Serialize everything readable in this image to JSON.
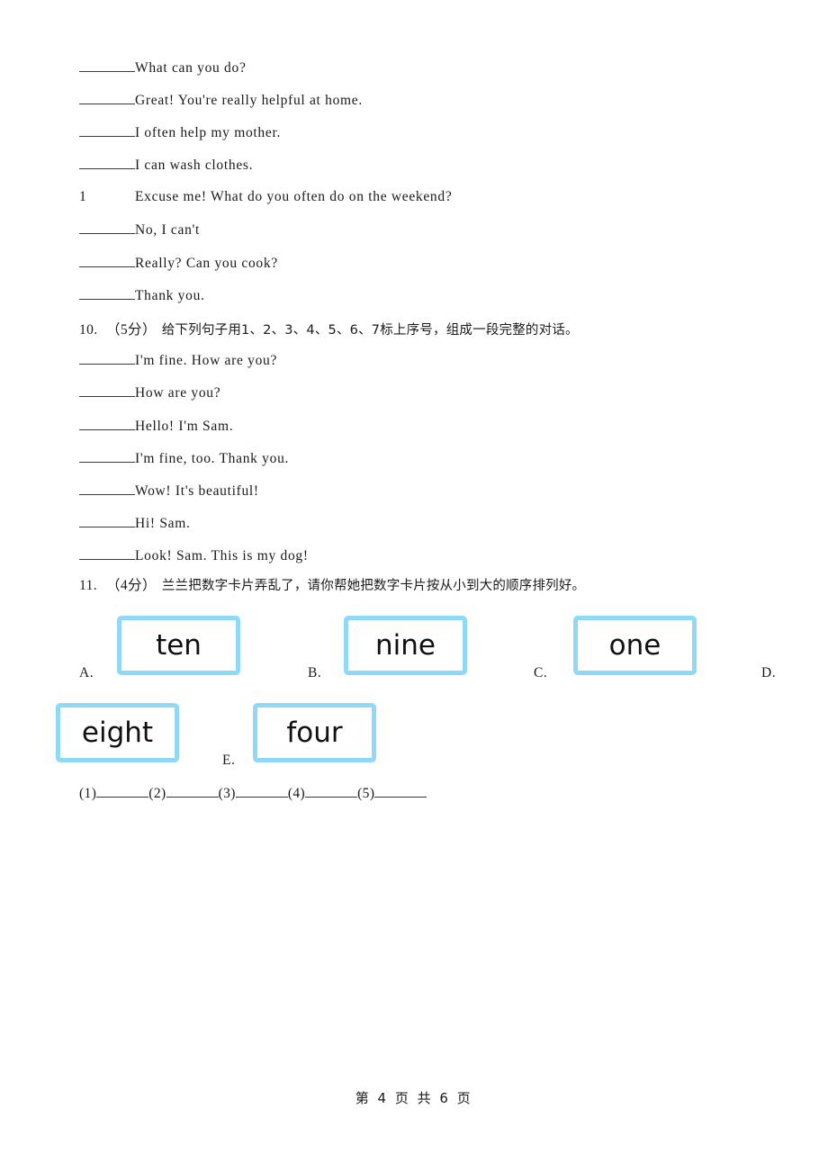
{
  "document": {
    "type": "exam-paper-page",
    "footer": "第 4 页 共 6 页"
  },
  "continued_question": {
    "lines": [
      {
        "kind": "blank",
        "text": "What can you do?"
      },
      {
        "kind": "blank",
        "text": "Great! You're really helpful at home."
      },
      {
        "kind": "blank",
        "text": "I often help my mother."
      },
      {
        "kind": "blank",
        "text": "I can wash clothes."
      },
      {
        "kind": "numbered",
        "index": "1",
        "text": "Excuse me! What do you often do on the weekend?"
      },
      {
        "kind": "blank",
        "text": "No, I can't"
      },
      {
        "kind": "blank",
        "text": "Really? Can you cook?"
      },
      {
        "kind": "blank",
        "text": "Thank you."
      }
    ]
  },
  "question10": {
    "number": "10.",
    "score": "（5分）",
    "prompt": "给下列句子用1、2、3、4、5、6、7标上序号，组成一段完整的对话。",
    "items": [
      "I'm fine. How are you?",
      "How are you?",
      "Hello! I'm Sam.",
      "I'm fine, too. Thank you.",
      "Wow! It's beautiful!",
      "Hi! Sam.",
      "Look! Sam. This is my dog!"
    ]
  },
  "question11": {
    "number": "11.",
    "score": "（4分）",
    "prompt": "兰兰把数字卡片弄乱了，请你帮她把数字卡片按从小到大的顺序排列好。",
    "card_border_color": "#8fd8f7",
    "options": [
      {
        "label": "A.",
        "word": "ten"
      },
      {
        "label": "B.",
        "word": "nine"
      },
      {
        "label": "C.",
        "word": "one"
      },
      {
        "label": "D.",
        "word": "eight"
      },
      {
        "label": "E.",
        "word": "four"
      }
    ],
    "answer_blanks": [
      "(1)",
      "(2)",
      "(3)",
      "(4)",
      "(5)"
    ]
  }
}
